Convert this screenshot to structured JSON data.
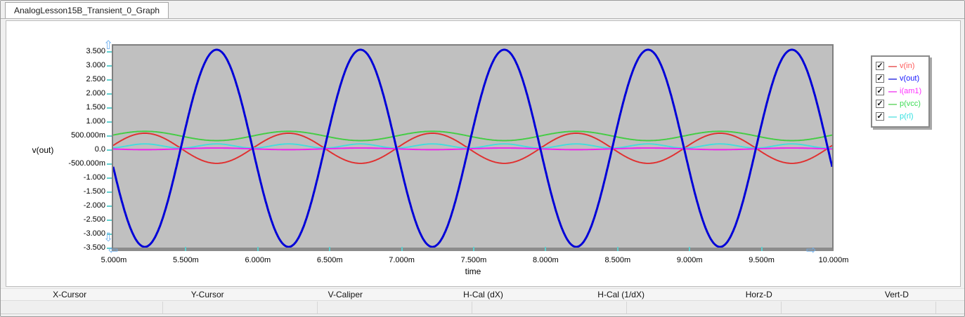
{
  "tab": {
    "title": "AnalogLesson15B_Transient_0_Graph"
  },
  "y_axis": {
    "label": "v(out)",
    "tick_labels": [
      "3.500",
      "3.000",
      "2.500",
      "2.000",
      "1.500",
      "1.000",
      "500.000m",
      "0.0",
      "-500.000m",
      "-1.000",
      "-1.500",
      "-2.000",
      "-2.500",
      "-3.000",
      "-3.500"
    ]
  },
  "x_axis": {
    "label": "time",
    "tick_labels": [
      "5.000m",
      "5.500m",
      "6.000m",
      "6.500m",
      "7.000m",
      "7.500m",
      "8.000m",
      "8.500m",
      "9.000m",
      "9.500m",
      "10.000m"
    ]
  },
  "icons": {
    "pan_up_glyph": "⇧",
    "pan_down_glyph": "⇩",
    "pan_left_glyph": "⇦",
    "pan_right_glyph": "⇨",
    "check_glyph": "✓"
  },
  "legend": {
    "items": [
      {
        "label": "v(in)",
        "checked": true,
        "text_color": "#ff5a5a",
        "line_color": "#e03030"
      },
      {
        "label": "v(out)",
        "checked": true,
        "text_color": "#1414ff",
        "line_color": "#0000d8"
      },
      {
        "label": "i(am1)",
        "checked": true,
        "text_color": "#ff30ff",
        "line_color": "#ee22ee"
      },
      {
        "label": "p(vcc)",
        "checked": true,
        "text_color": "#3ddd55",
        "line_color": "#44cc44"
      },
      {
        "label": "p(rl)",
        "checked": true,
        "text_color": "#30e0e0",
        "line_color": "#44dddd"
      }
    ]
  },
  "cursor_table": {
    "headers": [
      "X-Cursor",
      "Y-Cursor",
      "V-Caliper",
      "H-Cal (dX)",
      "H-Cal (1/dX)",
      "Horz-D",
      "Vert-D"
    ],
    "values": [
      "",
      "",
      "",
      "",
      "",
      "",
      ""
    ]
  },
  "chart_data": {
    "type": "line",
    "title": "",
    "xlabel": "time",
    "ylabel": "v(out)",
    "x_range_ms": [
      5.0,
      10.0
    ],
    "x_ticks_ms": [
      5.0,
      5.5,
      6.0,
      6.5,
      7.0,
      7.5,
      8.0,
      8.5,
      9.0,
      9.5,
      10.0
    ],
    "y_ticks": [
      3.5,
      3.0,
      2.5,
      2.0,
      1.5,
      1.0,
      0.5,
      0.0,
      -0.5,
      -1.0,
      -1.5,
      -2.0,
      -2.5,
      -3.0,
      -3.5
    ],
    "ylim": [
      -3.69,
      3.75
    ],
    "grid": false,
    "legend_position": "right-outside",
    "plot_background": "#c0c0c0",
    "series": [
      {
        "name": "v(in)",
        "color": "#e03030",
        "waveform": "sine",
        "offset": 0.0,
        "amplitude": 0.55,
        "period_ms": 1.0,
        "peak_at_ms": 5.22,
        "stroke_width": 2
      },
      {
        "name": "v(out)",
        "color": "#0000d8",
        "waveform": "sine",
        "offset": 0.0,
        "amplitude": 3.6,
        "period_ms": 1.0,
        "peak_at_ms": 5.72,
        "stroke_width": 3
      },
      {
        "name": "i(am1)",
        "color": "#ee22ee",
        "waveform": "sine",
        "offset": -0.02,
        "amplitude": 0.03,
        "period_ms": 1.0,
        "peak_at_ms": 5.72,
        "stroke_width": 2
      },
      {
        "name": "p(vcc)",
        "color": "#44cc44",
        "waveform": "sine",
        "offset": 0.45,
        "amplitude": 0.17,
        "period_ms": 1.0,
        "peak_at_ms": 5.22,
        "stroke_width": 2
      },
      {
        "name": "p(rl)",
        "color": "#44dddd",
        "waveform": "sine",
        "offset": 0.085,
        "amplitude": 0.075,
        "period_ms": 0.5,
        "peak_at_ms": 5.22,
        "stroke_width": 2
      }
    ],
    "draw_order": [
      "v(in)",
      "p(vcc)",
      "p(rl)",
      "i(am1)",
      "v(out)"
    ]
  }
}
